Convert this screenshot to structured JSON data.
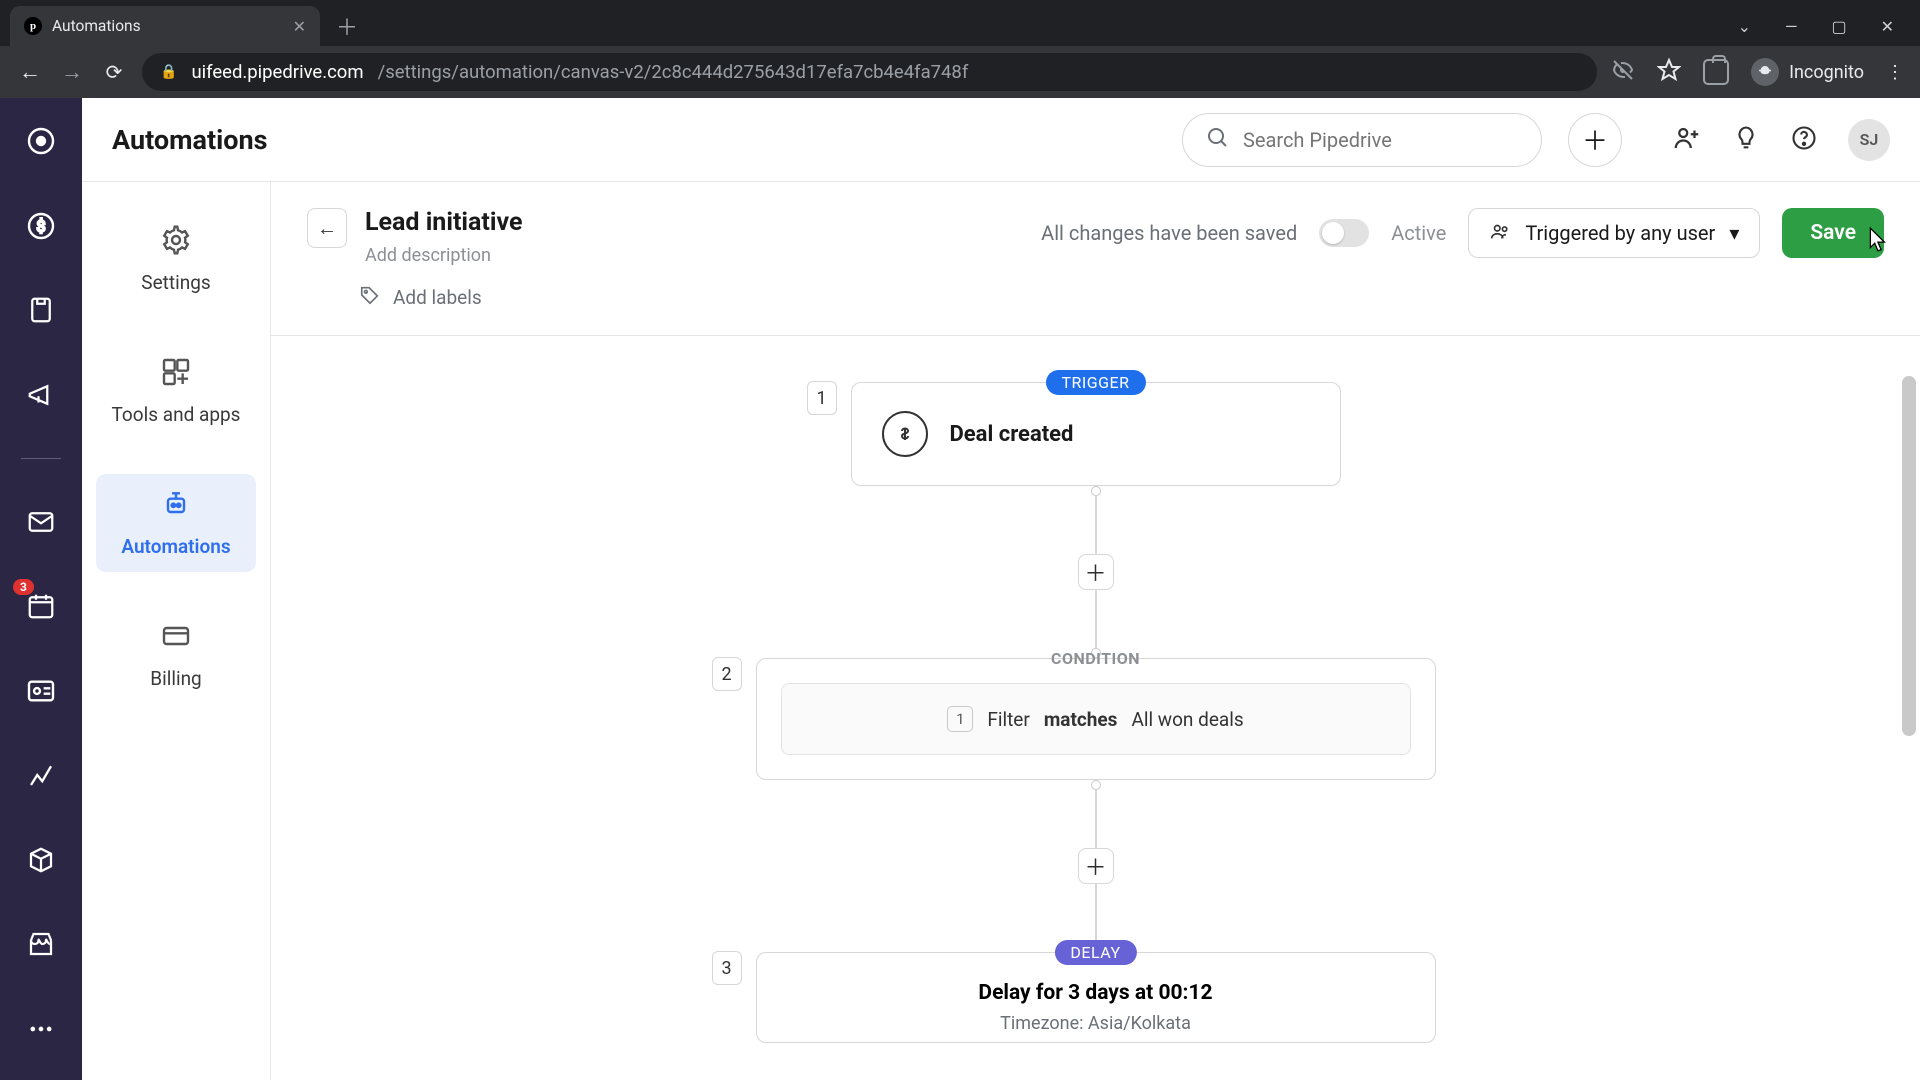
{
  "browser": {
    "tab_title": "Automations",
    "url_host": "uifeed.pipedrive.com",
    "url_path": "/settings/automation/canvas-v2/2c8c444d275643d17efa7cb4e4fa748f",
    "incognito_label": "Incognito"
  },
  "header": {
    "title": "Automations",
    "search_placeholder": "Search Pipedrive",
    "avatar_initials": "SJ"
  },
  "sidebar": {
    "items": [
      {
        "label": "Settings"
      },
      {
        "label": "Tools and apps"
      },
      {
        "label": "Automations"
      },
      {
        "label": "Billing"
      }
    ]
  },
  "vnav": {
    "badge": "3"
  },
  "editor": {
    "title": "Lead initiative",
    "add_description": "Add description",
    "add_labels": "Add labels",
    "saved_text": "All changes have been saved",
    "active_label": "Active",
    "trigger_scope": "Triggered by any user",
    "save_label": "Save"
  },
  "flow": {
    "steps": [
      {
        "num": "1",
        "badge": "TRIGGER",
        "title": "Deal created"
      },
      {
        "num": "2",
        "badge": "CONDITION",
        "filter_num": "1",
        "filter_word": "Filter",
        "match_word": "matches",
        "filter_value": "All won deals"
      },
      {
        "num": "3",
        "badge": "DELAY",
        "title": "Delay for 3 days at 00:12",
        "subtitle": "Timezone: Asia/Kolkata"
      }
    ]
  }
}
